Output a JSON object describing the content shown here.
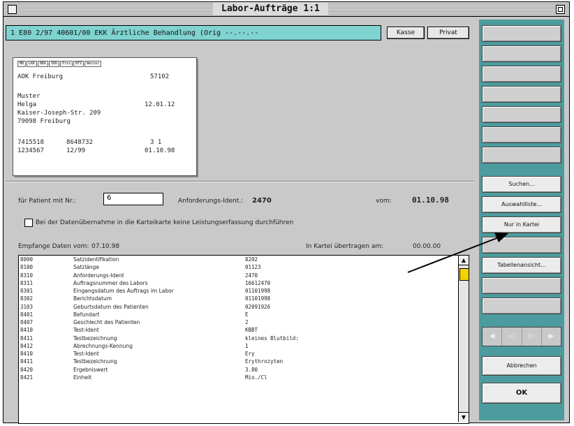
{
  "window": {
    "title": "Labor-Aufträge   1:1"
  },
  "header": {
    "case_line": "1  E80 2/97  40601/00  EKK  Ärztliche Behandlung (Orig  --.--.--",
    "kasse_label": "Kasse",
    "privat_label": "Privat"
  },
  "card": {
    "tabs": [
      "MB",
      "LKK",
      "BKK",
      "IKK",
      "Priv",
      "KFZ",
      "Weiter"
    ],
    "insurer": "AOK Freiburg",
    "insurer_no": "57102",
    "lastname": "Muster",
    "firstname": "Helga",
    "birthdate": "12.01.12",
    "street": "Kaiser-Joseph-Str. 209",
    "city": "79098 Freiburg",
    "row1_a": "7415518",
    "row1_b": "8648732",
    "row1_c": "3 1",
    "row2_a": "1234567",
    "row2_b": "12/99",
    "row2_c": "01.10.98"
  },
  "form": {
    "patient_label": "für Patient mit Nr.:",
    "patient_value": "6",
    "ident_label": "Anforderungs-Ident.:",
    "ident_value": "2470",
    "vom_label": "vom:",
    "vom_value": "01.10.98",
    "checkbox_label": "Bei der Datenübernahme in die Karteikarte keine Leistungserfassung durchführen",
    "empf_label": "Empfange Daten vom:",
    "empf_value": "07.10.98",
    "kartei_label": "In Kartei übertragen am:",
    "kartei_value": "00.00.00"
  },
  "list": {
    "rows": [
      [
        "8000",
        "Satzidentifikation",
        "8202"
      ],
      [
        "8100",
        "Satzlänge",
        "01123"
      ],
      [
        "8310",
        "Anforderungs-Ident",
        "2470"
      ],
      [
        "8311",
        "Auftragsnummer des Labors",
        "16612470"
      ],
      [
        "8301",
        "Eingangsdatum des Auftrags im Labor",
        "01101998"
      ],
      [
        "8302",
        "Berichtsdatum",
        "01101998"
      ],
      [
        "3103",
        "Geburtsdatum des Patienten",
        "02091926"
      ],
      [
        "8401",
        "Befundart",
        "E"
      ],
      [
        "8407",
        "Geschlecht des Patienten",
        "2"
      ],
      [
        "8410",
        "Test-Ident",
        "KBBT"
      ],
      [
        "8411",
        "Testbezeichnung",
        "kleines Blutbild:"
      ],
      [
        "8412",
        "Abrechnungs-Kennung",
        "1"
      ],
      [
        "8410",
        "Test-Ident",
        "Ery"
      ],
      [
        "8411",
        "Testbezeichnung",
        "Erythrozyten"
      ],
      [
        "8420",
        "Ergebniswert",
        "3.80"
      ],
      [
        "8421",
        "Einheit",
        "Mio./Cl"
      ]
    ]
  },
  "sidebar": {
    "suchen": "Suchen...",
    "auswahlliste": "Auswahlliste...",
    "nur_in_kartei": "Nur in Kartei",
    "tabellenansicht": "Tabellenansicht...",
    "abbrechen": "Abbrechen",
    "ok": "OK"
  },
  "colors": {
    "case_bar": "#7fd3d0",
    "sidebar": "#4c9b9e",
    "scroll_thumb": "#f2d300"
  }
}
